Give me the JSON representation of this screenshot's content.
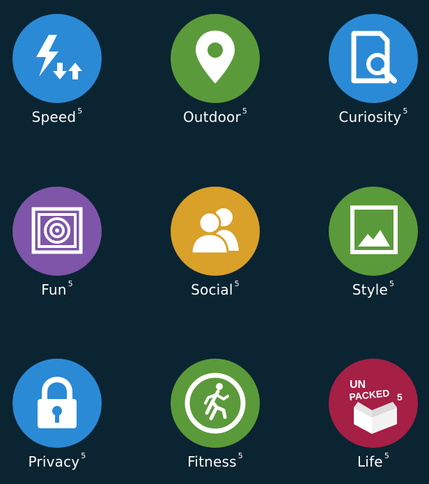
{
  "colors": {
    "background": "#0b2431",
    "blue": "#2b8ad6",
    "green": "#5b9a3a",
    "purple": "#7e55a8",
    "gold": "#d9a02a",
    "crimson": "#a61f45",
    "label": "#ffffff"
  },
  "tiles": [
    {
      "label": "Speed",
      "sup": "5",
      "icon": "lightning-bolt-arrows-icon",
      "color": "#2b8ad6"
    },
    {
      "label": "Outdoor",
      "sup": "5",
      "icon": "map-pin-icon",
      "color": "#5b9a3a"
    },
    {
      "label": "Curiosity",
      "sup": "5",
      "icon": "document-magnifier-icon",
      "color": "#2b8ad6"
    },
    {
      "label": "Fun",
      "sup": "5",
      "icon": "concentric-frames-icon",
      "color": "#7e55a8"
    },
    {
      "label": "Social",
      "sup": "5",
      "icon": "people-icon",
      "color": "#d9a02a"
    },
    {
      "label": "Style",
      "sup": "5",
      "icon": "picture-frame-icon",
      "color": "#5b9a3a"
    },
    {
      "label": "Privacy",
      "sup": "5",
      "icon": "padlock-icon",
      "color": "#2b8ad6"
    },
    {
      "label": "Fitness",
      "sup": "5",
      "icon": "runner-icon",
      "color": "#5b9a3a"
    },
    {
      "label": "Life",
      "sup": "5",
      "icon": "unpacked-box-icon",
      "color": "#a61f45",
      "icon_text": [
        "UN",
        "PACKED",
        "5"
      ]
    }
  ]
}
